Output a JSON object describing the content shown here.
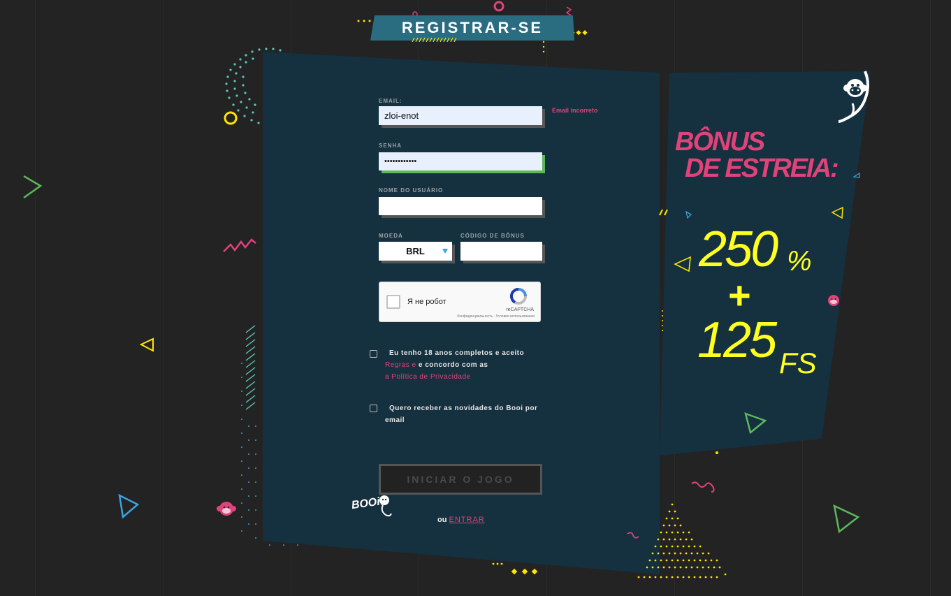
{
  "page_title": "REGISTRAR-SE",
  "form": {
    "email_label": "EMAIL:",
    "email_value": "zloi-enot",
    "email_error": "Email incorreto",
    "password_label": "SENHA",
    "password_value": "••••••••••••",
    "username_label": "NOME DO USUÁRIO",
    "username_value": "",
    "currency_label": "MOEDA",
    "currency_value": "BRL",
    "bonus_code_label": "CÓDIGO DE BÔNUS",
    "bonus_code_value": ""
  },
  "captcha": {
    "label": "Я не робот",
    "brand": "reCAPTCHA",
    "terms": "Конфиденциальность - Условия использования"
  },
  "consent": {
    "line1": "Eu tenho 18 anos completos e aceito",
    "rules_link": "Regras e",
    "line2": "e concordo com as",
    "privacy_link": "a Política de Privacidade",
    "newsletter_line1": "Quero receber as novidades do Booi por",
    "newsletter_line2": "email"
  },
  "start_button": "INICIAR O JOGO",
  "login": {
    "prefix": "ou",
    "link": "ENTRAR"
  },
  "logo_text": "BOOi!",
  "bonus": {
    "heading_line1": "BÔNUS",
    "heading_line2": "DE ESTREIA:",
    "percent_value": "250",
    "percent_sign": "%",
    "plus": "+",
    "fs_value": "125",
    "fs_label": "FS"
  },
  "colors": {
    "background": "#232323",
    "panel": "#15303e",
    "accent_pink": "#e0437a",
    "accent_yellow": "#ffff21",
    "banner": "#2a6c80"
  }
}
